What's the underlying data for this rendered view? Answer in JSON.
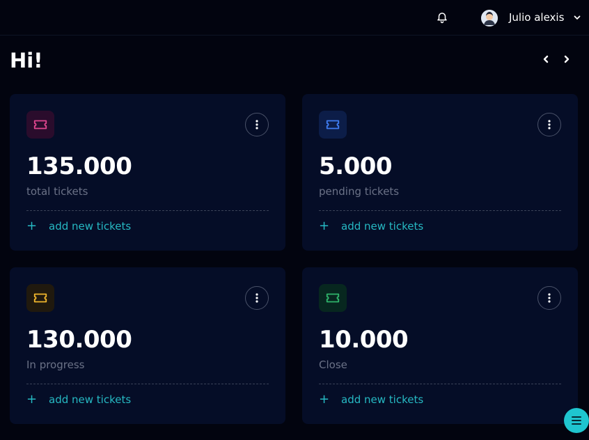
{
  "header": {
    "notification_icon": "bell-icon",
    "user_name": "Julio alexis",
    "user_menu_icon": "chevron-down-icon"
  },
  "greeting": "Hi!",
  "navigation": {
    "prev_icon": "chevron-left-icon",
    "next_icon": "chevron-right-icon"
  },
  "cards": [
    {
      "count": "135.000",
      "caption": "total tickets",
      "action": "add new tickets",
      "accent": "#e0468f",
      "badge_bg": "#2a0c2c"
    },
    {
      "count": "5.000",
      "caption": "pending tickets",
      "action": "add new tickets",
      "accent": "#3f7df2",
      "badge_bg": "#0c1d48"
    },
    {
      "count": "130.000",
      "caption": "In progress",
      "action": "add new tickets",
      "accent": "#f0b62d",
      "badge_bg": "#20190e"
    },
    {
      "count": "10.000",
      "caption": "Close",
      "action": "add new tickets",
      "accent": "#2fb56b",
      "badge_bg": "#07271f"
    }
  ],
  "colors": {
    "background": "#02040f",
    "card": "#050d27",
    "link": "#26b9c3",
    "fab": "#1fc5cf"
  },
  "fab_icon": "menu-icon"
}
